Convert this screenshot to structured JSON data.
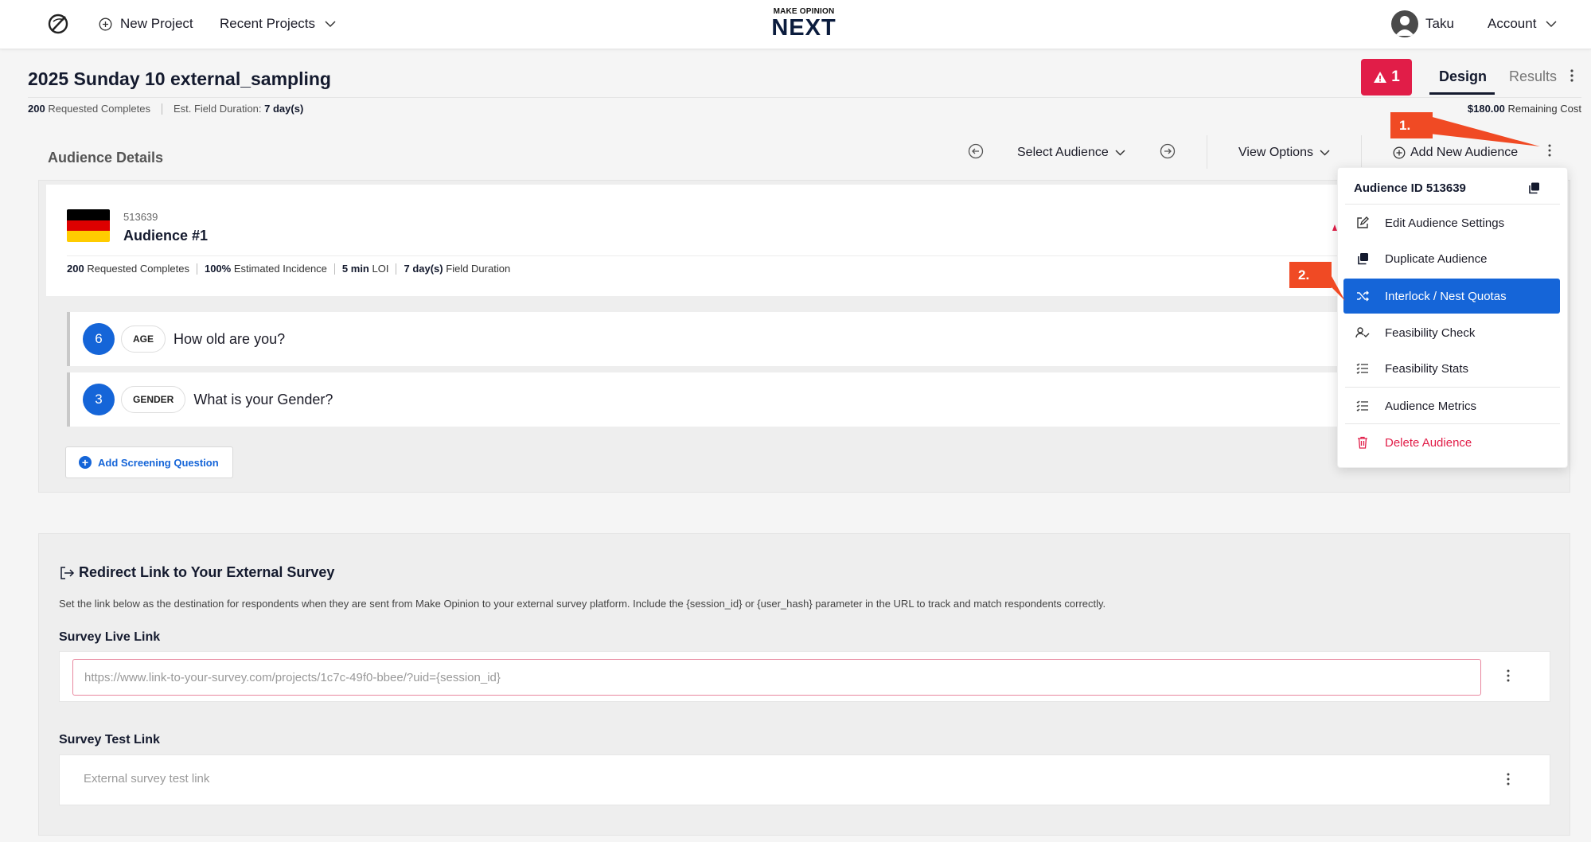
{
  "nav": {
    "new_project": "New Project",
    "recent_projects": "Recent Projects",
    "brand_small": "MAKE OPINION",
    "brand_big": "NEXT",
    "user_name": "Taku",
    "account": "Account"
  },
  "project": {
    "title": "2025 Sunday 10 external_sampling",
    "requested_value": "200",
    "requested_label": "Requested Completes",
    "duration_label": "Est. Field Duration:",
    "duration_value": "7 day(s)",
    "alert_count": "1",
    "tab_design": "Design",
    "tab_results": "Results",
    "remaining_value": "$180.00",
    "remaining_label": "Remaining Cost"
  },
  "toolbar": {
    "audience_details": "Audience Details",
    "select_audience": "Select Audience",
    "view_options": "View Options",
    "add_new_audience": "Add New Audience"
  },
  "audience": {
    "id": "513639",
    "name": "Audience #1",
    "stats": [
      {
        "value": "200",
        "label": "Requested Completes"
      },
      {
        "value": "100%",
        "label": "Estimated Incidence"
      },
      {
        "value": "5 min",
        "label": "LOI"
      },
      {
        "value": "7 day(s)",
        "label": "Field Duration"
      }
    ],
    "questions": [
      {
        "count": "6",
        "tag": "AGE",
        "text": "How old are you?"
      },
      {
        "count": "3",
        "tag": "GENDER",
        "text": "What is your Gender?"
      }
    ],
    "add_screening": "Add Screening Question"
  },
  "menu": {
    "header": "Audience ID 513639",
    "items": [
      {
        "label": "Edit Audience Settings",
        "icon": "edit-icon"
      },
      {
        "label": "Duplicate Audience",
        "icon": "duplicate-icon"
      },
      {
        "label": "Interlock / Nest Quotas",
        "icon": "shuffle-icon"
      },
      {
        "label": "Feasibility Check",
        "icon": "user-check-icon"
      },
      {
        "label": "Feasibility Stats",
        "icon": "list-check-icon"
      },
      {
        "label": "Audience Metrics",
        "icon": "list-check-icon"
      },
      {
        "label": "Delete Audience",
        "icon": "trash-icon"
      }
    ]
  },
  "redirect": {
    "title": "Redirect Link to Your External Survey",
    "description": "Set the link below as the destination for respondents when they are sent from Make Opinion to your external survey platform. Include the {session_id} or {user_hash} parameter in the URL to track and match respondents correctly.",
    "live_label": "Survey Live Link",
    "live_placeholder": "https://www.link-to-your-survey.com/projects/1c7c-49f0-bbee/?uid={session_id}",
    "test_label": "Survey Test Link",
    "test_placeholder": "External survey test link"
  },
  "annotations": {
    "step1": "1.",
    "step2": "2."
  },
  "colors": {
    "accent": "#1565d8",
    "danger": "#e11d48",
    "callout": "#f04a24",
    "flag_black": "#000000",
    "flag_red": "#dd0000",
    "flag_gold": "#ffcc00"
  }
}
